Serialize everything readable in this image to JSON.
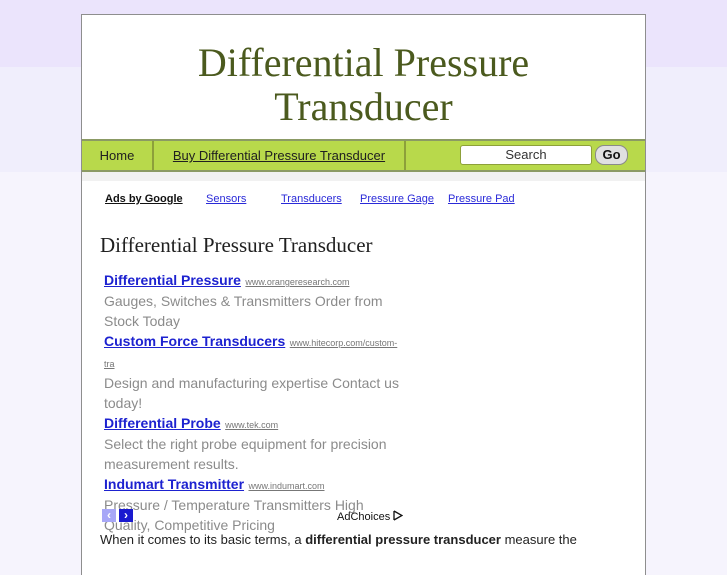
{
  "header": {
    "title": "Differential Pressure Transducer"
  },
  "nav": {
    "items": [
      {
        "label": "Home"
      },
      {
        "label": "Buy Differential Pressure Transducer"
      }
    ],
    "search_value": "Search",
    "go_label": "Go"
  },
  "ad_links": {
    "ads_by_label": "Ads by Google",
    "links": [
      "Sensors",
      "Transducers",
      "Pressure Gage",
      "Pressure Pad"
    ]
  },
  "main": {
    "title": "Differential Pressure Transducer",
    "ads": [
      {
        "title": "Differential Pressure",
        "url": "www.orangeresearch.com",
        "desc": "Gauges, Switches & Transmitters Order from Stock Today"
      },
      {
        "title": "Custom Force Transducers",
        "url": "www.hitecorp.com/custom-tra",
        "desc": "Design and manufacturing expertise Contact us today!"
      },
      {
        "title": "Differential Probe",
        "url": "www.tek.com",
        "desc": "Select the right probe equipment for precision measurement results."
      },
      {
        "title": "Indumart Transmitter",
        "url": "www.indumart.com",
        "desc": "Pressure / Temperature Transmitters High Quality, Competitive Pricing"
      }
    ],
    "ad_nav": {
      "prev": "‹",
      "next": "›"
    },
    "adchoices_label": "AdChoices",
    "body": {
      "before": "When it comes to its basic terms, a ",
      "bold": "differential pressure transducer",
      "after": " measure the"
    }
  },
  "colors": {
    "nav_bg": "#b8d94b",
    "title_color": "#4b5a1e",
    "ad_link": "#1d22d0"
  }
}
